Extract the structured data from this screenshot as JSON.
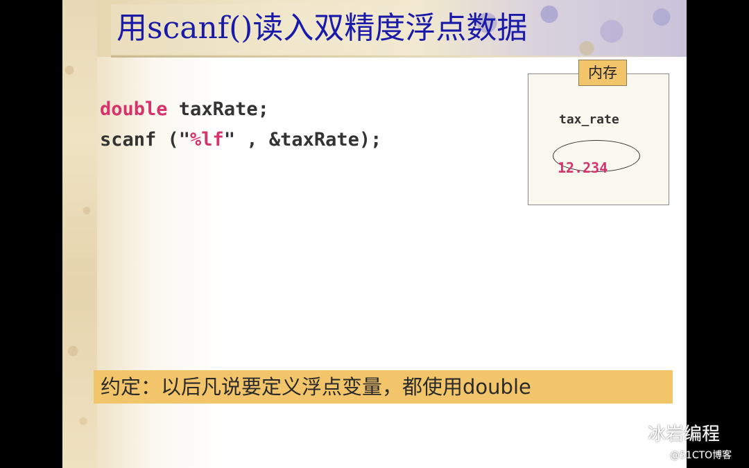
{
  "title": "用scanf()读入双精度浮点数据",
  "code": {
    "line1": {
      "keyword": "double",
      "rest": " taxRate;"
    },
    "line2": {
      "pre": "scanf (\"",
      "format": "%lf",
      "post": "\" , &taxRate);"
    }
  },
  "memory": {
    "label": "内存",
    "var_name": "tax_rate",
    "value": "12.234"
  },
  "note": "约定：以后凡说要定义浮点变量，都使用double",
  "watermark": {
    "brand": "冰岩编程",
    "sub": "@51CTO博客"
  },
  "colors": {
    "title": "#1a1aa8",
    "keyword": "#d6336c",
    "note_bar": "#f3c56a"
  }
}
